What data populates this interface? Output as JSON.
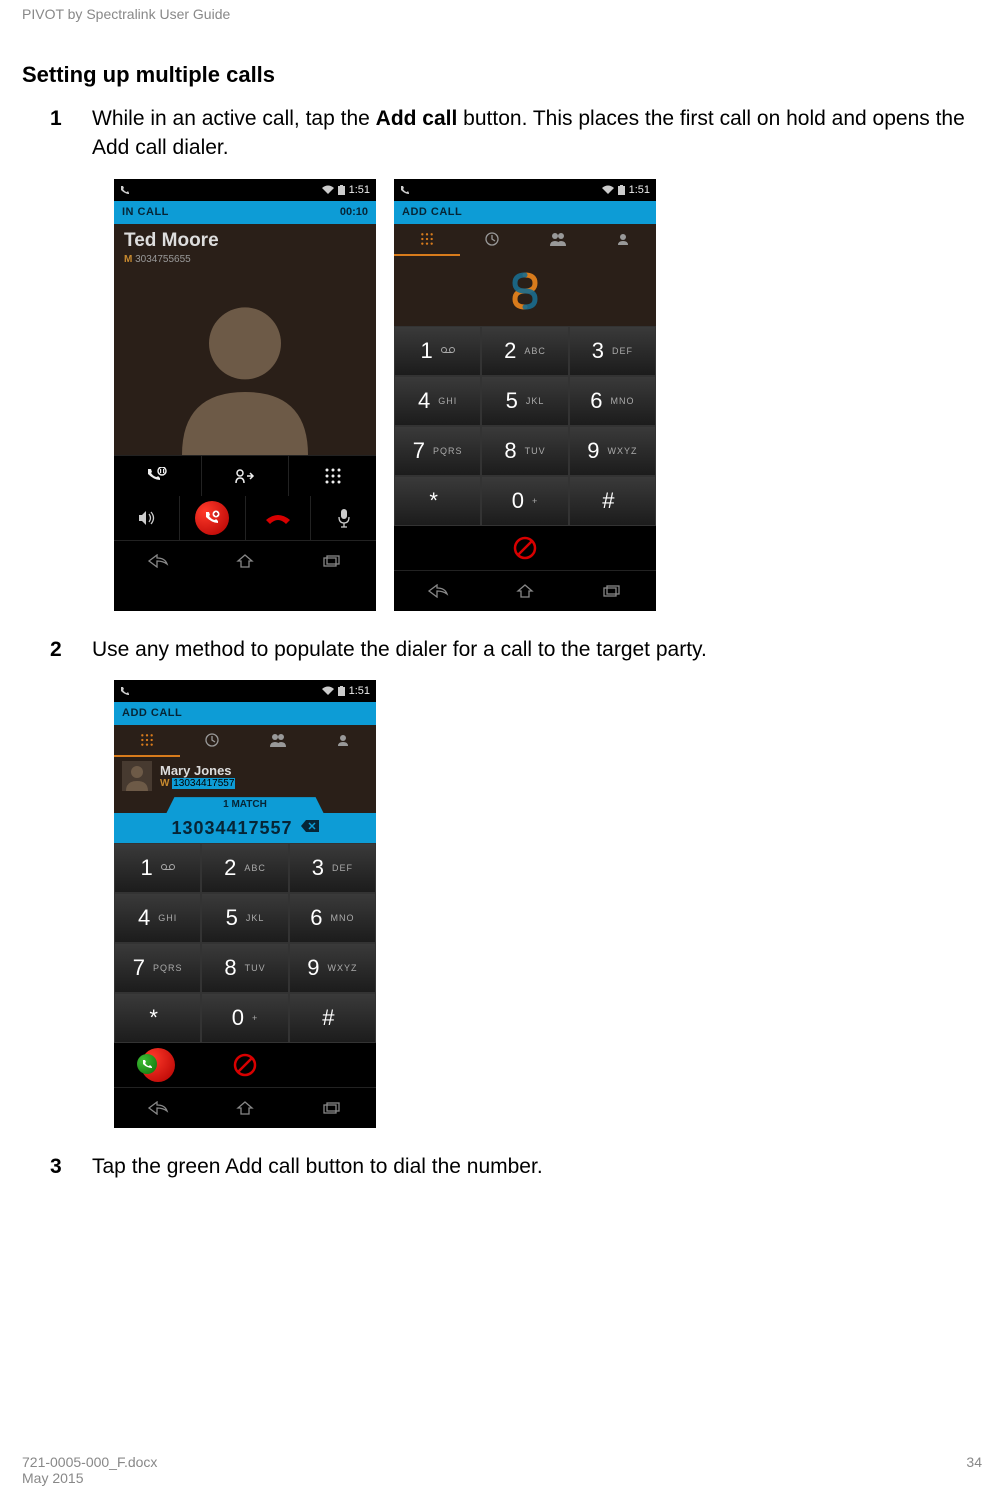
{
  "doc": {
    "header": "PIVOT by Spectralink User Guide",
    "sectionTitle": "Setting up multiple calls",
    "steps": {
      "n1": "1",
      "t1a": "While in an active call, tap the ",
      "t1b": "Add call",
      "t1c": " button. This places the first call on hold and opens the Add call dialer.",
      "n2": "2",
      "t2": "Use any method to populate the dialer for a call to the target party.",
      "n3": "3",
      "t3": "Tap the green Add call button to dial the number."
    },
    "footer": {
      "filename": "721-0005-000_F.docx",
      "date": "May 2015",
      "page": "34"
    }
  },
  "status": {
    "time": "1:51"
  },
  "screen1": {
    "blueLeft": "IN CALL",
    "blueRight": "00:10",
    "callerName": "Ted Moore",
    "callerPrefix": "M",
    "callerNumber": "3034755655"
  },
  "screen2": {
    "blueLeft": "ADD CALL"
  },
  "screen3": {
    "blueLeft": "ADD CALL",
    "suggName": "Mary Jones",
    "suggPrefix": "W",
    "suggNum": "13034417557",
    "matchLabel": "1 MATCH",
    "typed": "13034417557"
  },
  "keypad": {
    "k1": "1",
    "s1": "",
    "k2": "2",
    "s2": "ABC",
    "k3": "3",
    "s3": "DEF",
    "k4": "4",
    "s4": "GHI",
    "k5": "5",
    "s5": "JKL",
    "k6": "6",
    "s6": "MNO",
    "k7": "7",
    "s7": "PQRS",
    "k8": "8",
    "s8": "TUV",
    "k9": "9",
    "s9": "WXYZ",
    "kstar": "*",
    "sstar": "",
    "k0": "0",
    "s0": "+",
    "khash": "#",
    "shash": ""
  }
}
